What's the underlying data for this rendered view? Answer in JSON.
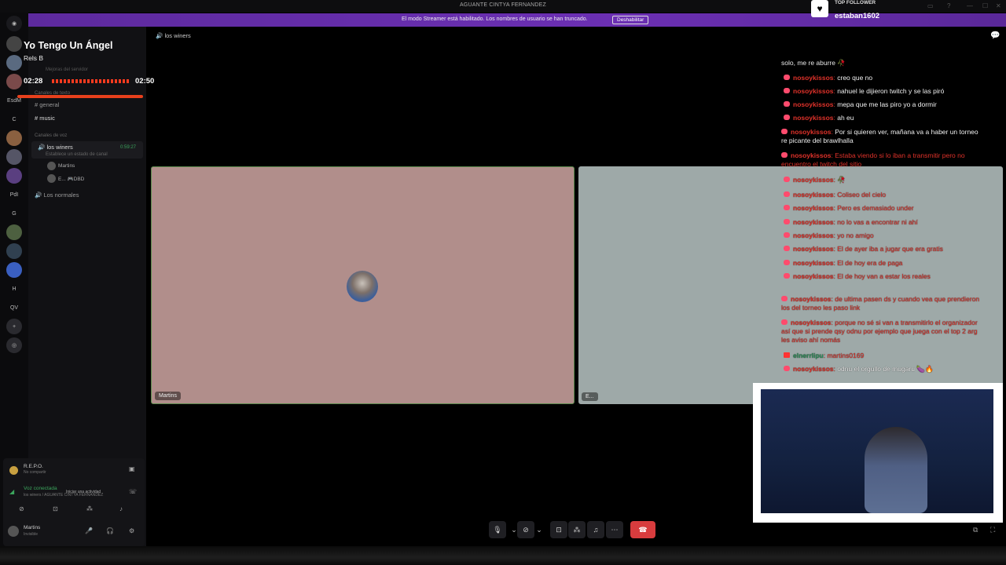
{
  "window": {
    "title": "AGUANTE CINTYA FERNANDEZ"
  },
  "banner": {
    "text": "El modo Streamer está habilitado. Los nombres de usuario se han truncado.",
    "button": "Deshabilitar"
  },
  "top_follower": {
    "label": "TOP FOLLOWER",
    "name": "estaban1602"
  },
  "now_playing": {
    "title": "Yo Tengo Un Ángel",
    "artist": "Rels B",
    "current": "02:28",
    "total": "02:50"
  },
  "servers": [
    "EsdM",
    "C",
    "PdI",
    "G",
    "H",
    "QV"
  ],
  "channels": {
    "header_faded": "Mejoras del servidor",
    "text_category": "Canales de texto",
    "text": [
      "general",
      "music"
    ],
    "voice_category": "Canales de voz",
    "active_voice": "los winers",
    "active_voice_timer": "0:59:27",
    "active_voice_status": "Establece un estado de canal",
    "members": [
      "Martins",
      "E... 🎮DBD"
    ],
    "other_voice": "Los normales"
  },
  "user_area": {
    "activity_title": "R.E.P.O.",
    "activity_sub": "No compartir",
    "voice_status": "Voz conectada",
    "voice_channel": "los winers / AGUANTE CINTYA FERNANDEZ",
    "activity_hint": "Iniciar una actividad",
    "username": "Martins",
    "user_status": "Invisible"
  },
  "call": {
    "breadcrumb": "los winers",
    "tile1_label": "Martins",
    "tile2_label": "E..."
  },
  "chat": [
    {
      "user": "",
      "msg": "solo, me re aburre 🥀"
    },
    {
      "user": "nosoykissos",
      "msg": "creo que no"
    },
    {
      "user": "nosoykissos",
      "msg": "nahuel le dijieron twitch y se las piró"
    },
    {
      "user": "nosoykissos",
      "msg": "mepa que me las piro yo a dormir"
    },
    {
      "user": "nosoykissos",
      "msg": "ah eu"
    },
    {
      "user": "nosoykissos",
      "msg": "Por si quieren ver, mañana va a haber un torneo re picante del brawlhalla"
    },
    {
      "user": "nosoykissos",
      "msg": "Estaba viendo si lo iban a transmitir pero no encuentro el twitch del sitio"
    },
    {
      "user": "nosoykissos",
      "msg": "🥀"
    },
    {
      "user": "nosoykissos",
      "msg": "Coliseo del cielo"
    },
    {
      "user": "nosoykissos",
      "msg": "Pero es demasiado under"
    },
    {
      "user": "nosoykissos",
      "msg": "no lo vas a encontrar ni ahí"
    },
    {
      "user": "nosoykissos",
      "msg": "yo no amigo"
    },
    {
      "user": "nosoykissos",
      "msg": "El de ayer iba a jugar que era gratis"
    },
    {
      "user": "nosoykissos",
      "msg": "El de hoy era de paga"
    },
    {
      "user": "nosoykissos",
      "msg": "El de hoy van a estar los reales"
    },
    {
      "user": "nosoykissos",
      "msg": "de ultima pasen ds y cuando vea que prendieron los del torneo les paso link"
    },
    {
      "user": "nosoykissos",
      "msg": "porque no sé si van a transmitirlo el organizador así que si prende qsy odnu por ejemplo que juega con el top 2 arg les aviso ahí nomás"
    },
    {
      "user": "elnerrlipu",
      "msg": "martins0169"
    },
    {
      "user": "nosoykissos",
      "msg": "odnu el orgullo de mugaru 🍆🔥"
    }
  ]
}
